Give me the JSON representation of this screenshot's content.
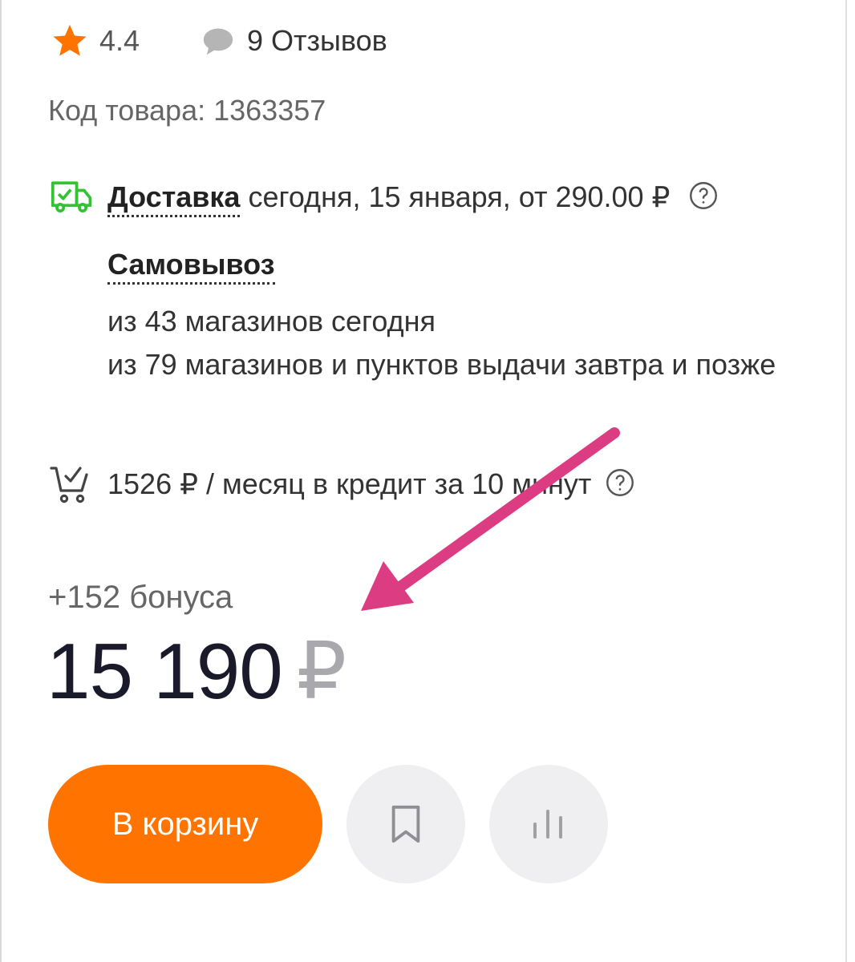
{
  "rating": {
    "value": "4.4",
    "reviews": "9 Отзывов"
  },
  "product_code": "Код товара: 1363357",
  "delivery": {
    "label": "Доставка",
    "details": "сегодня, 15 января, от 290.00 ₽"
  },
  "pickup": {
    "label": "Самовывоз",
    "lines": [
      "из 43 магазинов сегодня",
      "из 79 магазинов и пунктов выдачи завтра и позже"
    ]
  },
  "credit": {
    "text": "1526 ₽ / месяц в кредит за 10 минут"
  },
  "bonus": "+152 бонуса",
  "price": {
    "amount": "15 190",
    "currency": "₽"
  },
  "actions": {
    "add_to_cart": "В корзину"
  },
  "colors": {
    "accent": "#ff7300",
    "delivery_icon": "#33c233",
    "annotation_arrow": "#dc3c82"
  },
  "icons": {
    "rating": "star-icon",
    "reviews": "comment-icon",
    "delivery": "truck-icon",
    "help": "question-circle-icon",
    "credit": "cart-icon",
    "bookmark": "bookmark-icon",
    "compare": "bar-chart-icon"
  }
}
